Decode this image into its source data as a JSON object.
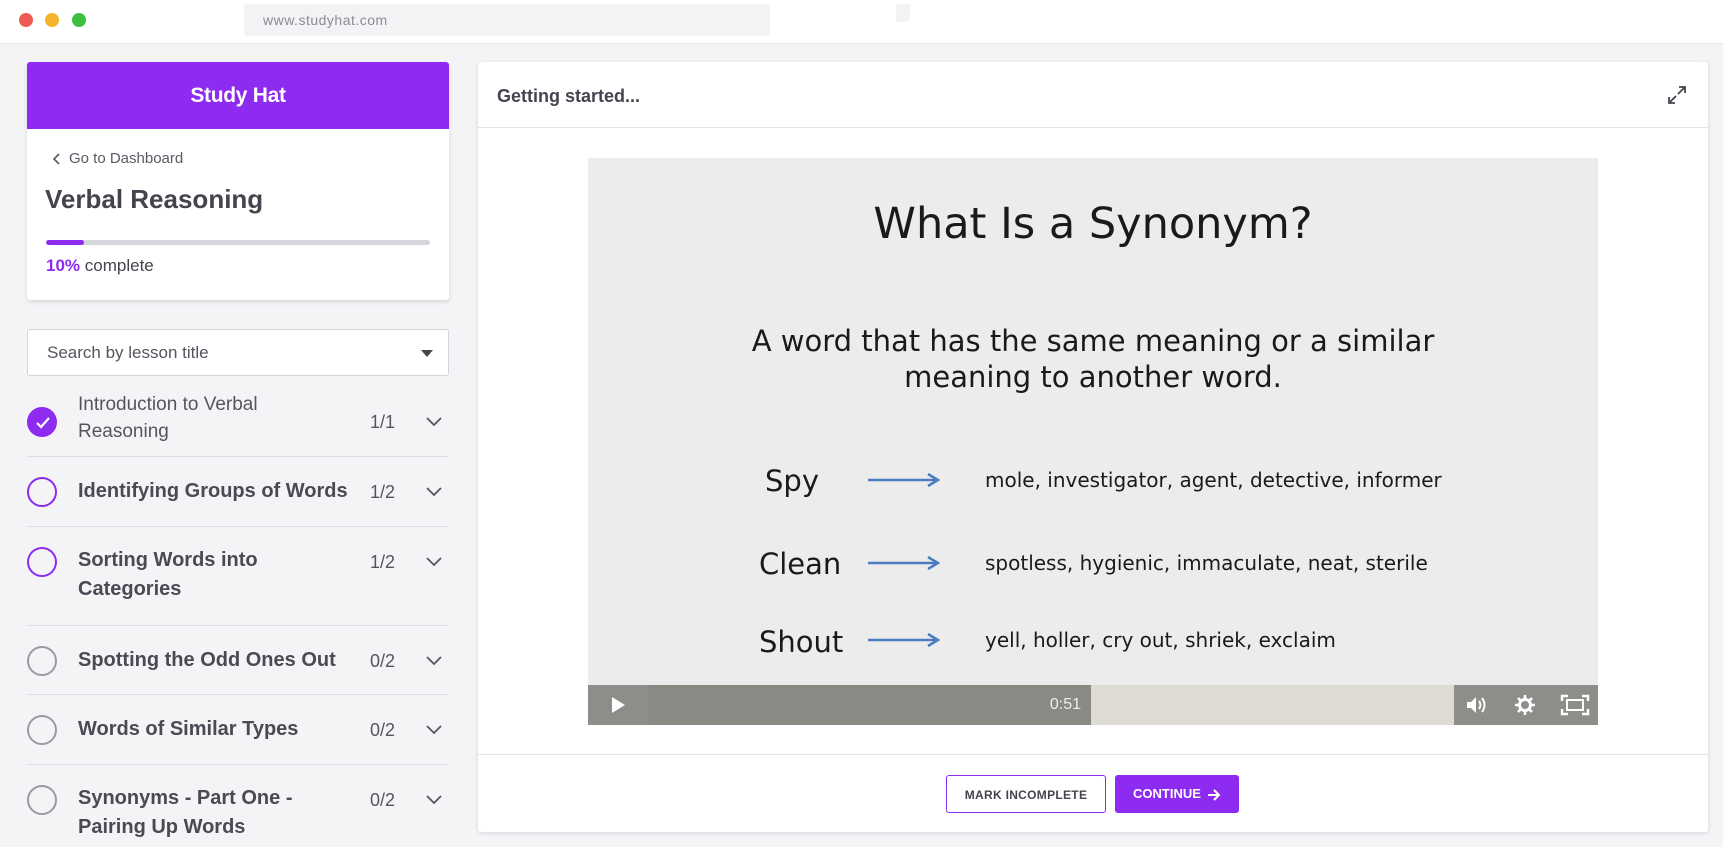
{
  "browser": {
    "url": "www.studyhat.com"
  },
  "sidebar": {
    "brand": "Study Hat",
    "back_label": "Go to Dashboard",
    "course_title": "Verbal Reasoning",
    "progress": {
      "percent_label": "10%",
      "suffix": "complete",
      "value": 0.1
    },
    "search_placeholder": "Search by lesson title",
    "lessons": [
      {
        "title": "Introduction to Verbal Reasoning",
        "count": "1/1",
        "state": "done"
      },
      {
        "title": "Identifying Groups of Words",
        "count": "1/2",
        "state": "in-progress"
      },
      {
        "title": "Sorting Words into Categories",
        "count": "1/2",
        "state": "in-progress"
      },
      {
        "title": "Spotting the Odd Ones Out",
        "count": "0/2",
        "state": "not-started"
      },
      {
        "title": "Words of Similar Types",
        "count": "0/2",
        "state": "not-started"
      },
      {
        "title": "Synonyms - Part One - Pairing Up Words",
        "count": "0/2",
        "state": "not-started"
      }
    ]
  },
  "main": {
    "heading": "Getting started...",
    "video": {
      "slide_title": "What Is a Synonym?",
      "definition": "A word that has the same meaning or a similar meaning to another word.",
      "examples": [
        {
          "word": "Spy",
          "synonyms": "mole, investigator, agent, detective, informer"
        },
        {
          "word": "Clean",
          "synonyms": "spotless, hygienic, immaculate, neat, sterile"
        },
        {
          "word": "Shout",
          "synonyms": "yell, holler, cry out, shriek, exclaim"
        }
      ],
      "time": "0:51",
      "played_fraction": 0.55
    },
    "buttons": {
      "mark_incomplete": "MARK INCOMPLETE",
      "continue": "CONTINUE"
    }
  },
  "colors": {
    "accent": "#8d2bf0",
    "arrow": "#4a7cc0"
  }
}
